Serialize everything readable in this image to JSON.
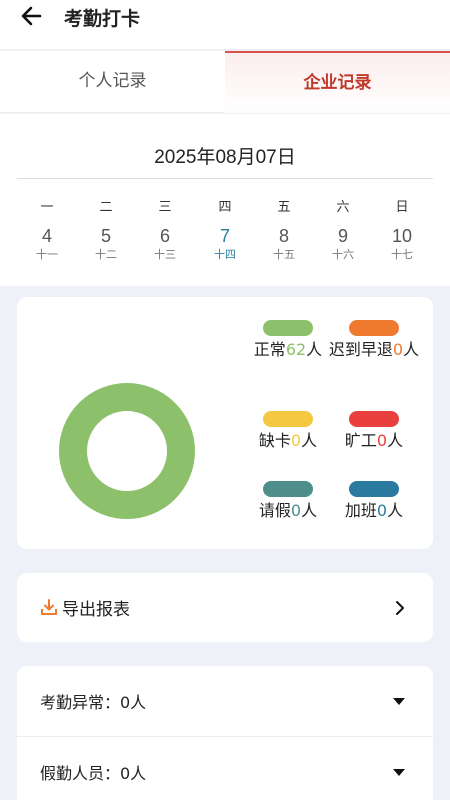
{
  "header": {
    "title": "考勤打卡"
  },
  "tabs": [
    {
      "label": "个人记录",
      "active": false
    },
    {
      "label": "企业记录",
      "active": true
    }
  ],
  "calendar": {
    "date": "2025年08月07日",
    "days": [
      {
        "weekday": "一",
        "day": "4",
        "lunar": "十一",
        "active": false
      },
      {
        "weekday": "二",
        "day": "5",
        "lunar": "十二",
        "active": false
      },
      {
        "weekday": "三",
        "day": "6",
        "lunar": "十三",
        "active": false
      },
      {
        "weekday": "四",
        "day": "7",
        "lunar": "十四",
        "active": true
      },
      {
        "weekday": "五",
        "day": "8",
        "lunar": "十五",
        "active": false
      },
      {
        "weekday": "六",
        "day": "9",
        "lunar": "十六",
        "active": false
      },
      {
        "weekday": "日",
        "day": "10",
        "lunar": "十七",
        "active": false
      }
    ]
  },
  "stats": {
    "unit": "人",
    "items": [
      {
        "label": "正常",
        "count": "62",
        "color": "#8dc06b"
      },
      {
        "label": "迟到早退",
        "count": "0",
        "color": "#ef7a2f"
      },
      {
        "label": "缺卡",
        "count": "0",
        "color": "#f5c842"
      },
      {
        "label": "旷工",
        "count": "0",
        "color": "#ea3f3f"
      },
      {
        "label": "请假",
        "count": "0",
        "color": "#4e8e8a"
      },
      {
        "label": "加班",
        "count": "0",
        "color": "#2a7aa0"
      }
    ]
  },
  "export": {
    "label": "导出报表",
    "icon": "download-icon",
    "icon_color": "#ef7a2f"
  },
  "list": [
    {
      "label": "考勤异常：0人"
    },
    {
      "label": "假勤人员：0人"
    }
  ]
}
